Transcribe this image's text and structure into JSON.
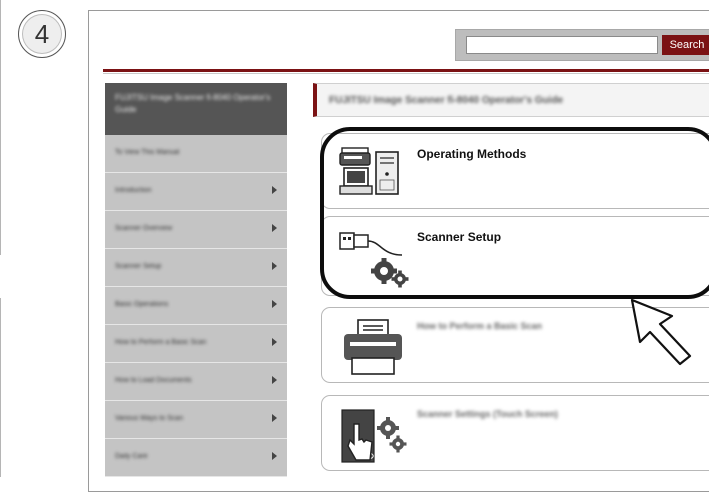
{
  "step": {
    "number": "4"
  },
  "search": {
    "button_label": "Search",
    "value": ""
  },
  "sidebar": {
    "title": "FUJITSU Image Scanner fi-8040 Operator's Guide",
    "items": [
      {
        "label": "To View This Manual",
        "has_arrow": false
      },
      {
        "label": "Introduction",
        "has_arrow": true
      },
      {
        "label": "Scanner Overview",
        "has_arrow": true
      },
      {
        "label": "Scanner Setup",
        "has_arrow": true
      },
      {
        "label": "Basic Operations",
        "has_arrow": true
      },
      {
        "label": "How to Perform a Basic Scan",
        "has_arrow": true
      },
      {
        "label": "How to Load Documents",
        "has_arrow": true
      },
      {
        "label": "Various Ways to Scan",
        "has_arrow": true
      },
      {
        "label": "Daily Care",
        "has_arrow": true
      }
    ]
  },
  "main": {
    "page_title": "FUJITSU Image Scanner fi-8040 Operator's Guide",
    "cards": [
      {
        "title": "Operating Methods",
        "icon": "computer-scanner-icon",
        "legible": true
      },
      {
        "title": "Scanner Setup",
        "icon": "usb-gear-icon",
        "legible": true
      },
      {
        "title": "How to Perform a Basic Scan",
        "icon": "scanner-icon",
        "legible": false
      },
      {
        "title": "Scanner Settings (Touch Screen)",
        "icon": "touch-gear-icon",
        "legible": false
      }
    ]
  },
  "colors": {
    "accent": "#7b1214",
    "sidebar_head": "#555555",
    "sidebar_item": "#c4c4c4"
  }
}
